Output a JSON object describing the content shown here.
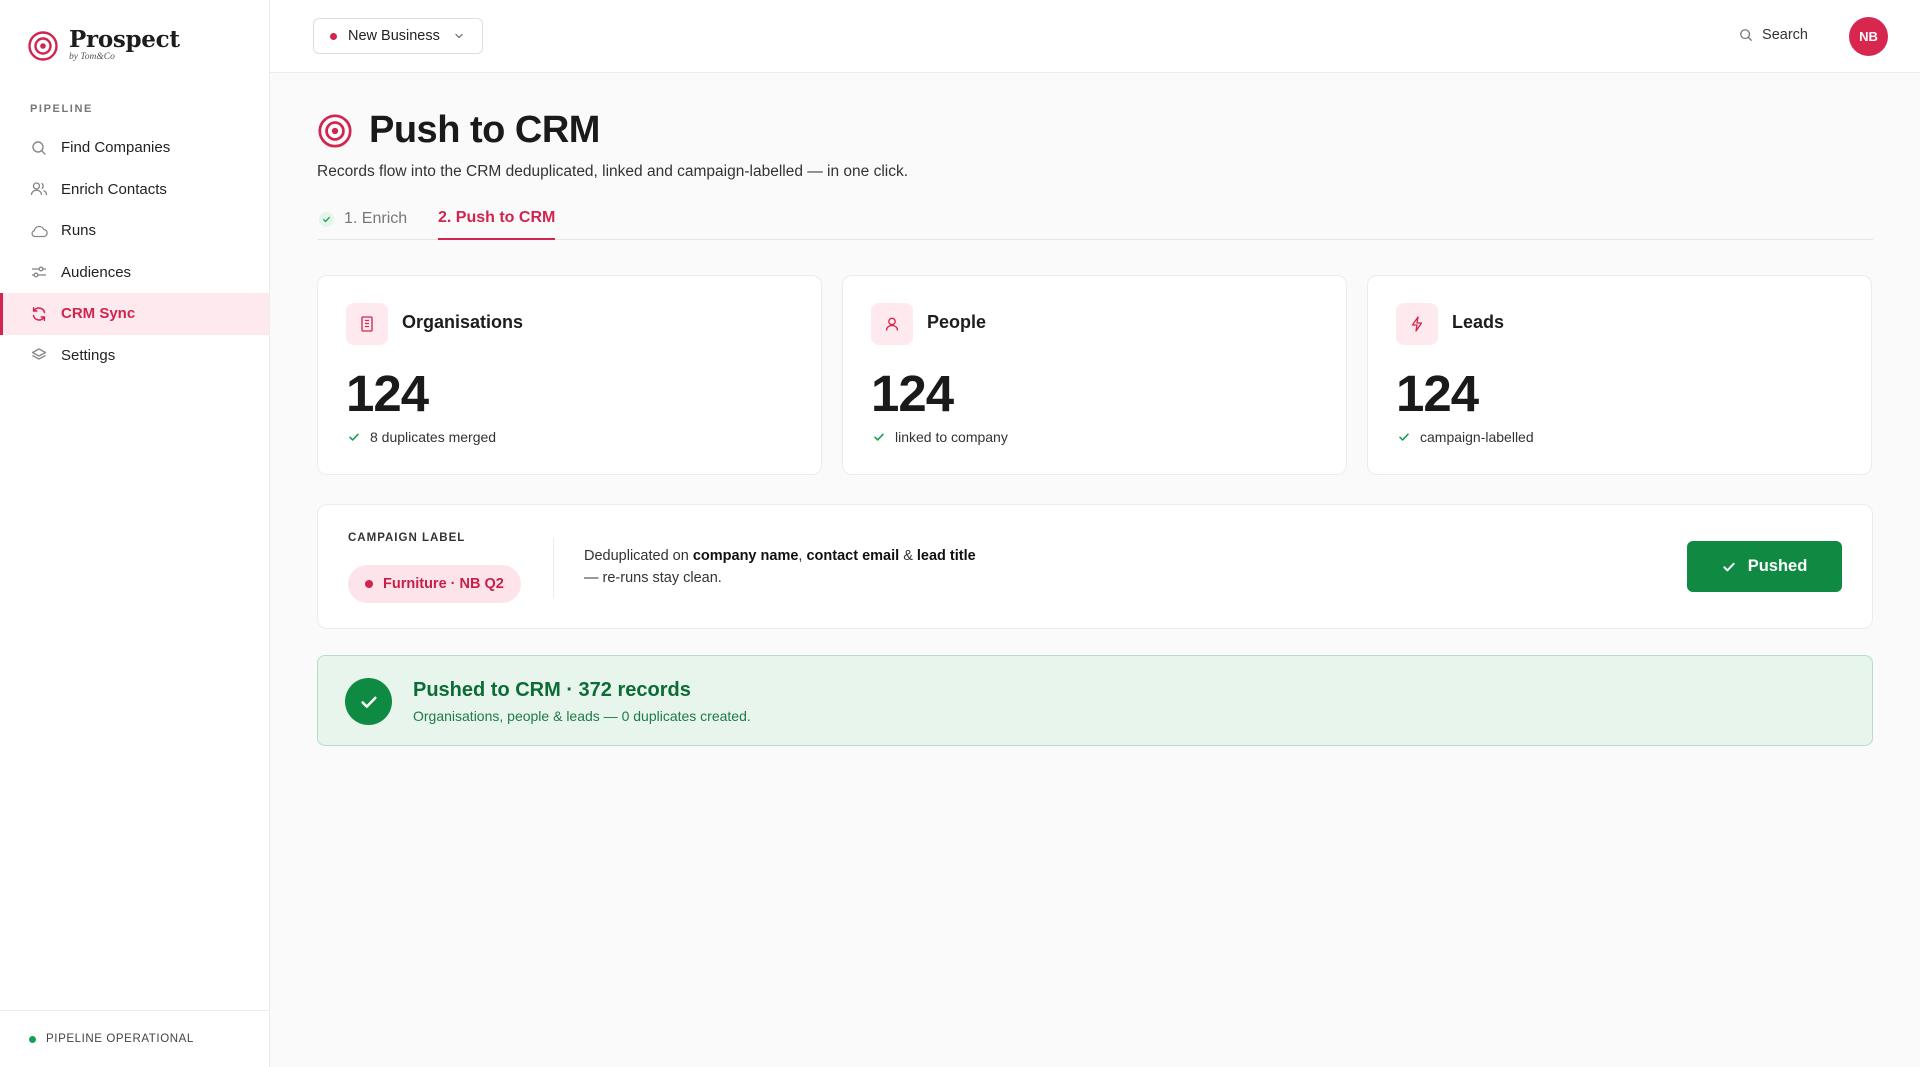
{
  "brand": {
    "name": "Prospect",
    "byline": "by Tom&Co"
  },
  "sidebar": {
    "section_title": "PIPELINE",
    "items": [
      {
        "label": "Find Companies",
        "icon": "search-icon",
        "active": false
      },
      {
        "label": "Enrich Contacts",
        "icon": "users-icon",
        "active": false
      },
      {
        "label": "Runs",
        "icon": "cloud-icon",
        "active": false
      },
      {
        "label": "Audiences",
        "icon": "sliders-icon",
        "active": false
      },
      {
        "label": "CRM Sync",
        "icon": "sync-icon",
        "active": true
      },
      {
        "label": "Settings",
        "icon": "layers-icon",
        "active": false
      }
    ],
    "footer_status": "PIPELINE OPERATIONAL"
  },
  "topbar": {
    "workspace": "New Business",
    "search_label": "Search",
    "avatar_initials": "NB"
  },
  "page": {
    "title": "Push to CRM",
    "subtitle": "Records flow into the CRM deduplicated, linked and campaign-labelled — in one click.",
    "tabs": [
      {
        "label": "1. Enrich",
        "state": "done"
      },
      {
        "label": "2. Push to CRM",
        "state": "active"
      }
    ]
  },
  "cards": [
    {
      "label": "Organisations",
      "icon": "building-icon",
      "value": "124",
      "note": "8 duplicates merged"
    },
    {
      "label": "People",
      "icon": "person-icon",
      "value": "124",
      "note": "linked to company"
    },
    {
      "label": "Leads",
      "icon": "bolt-icon",
      "value": "124",
      "note": "campaign-labelled"
    }
  ],
  "campaign": {
    "title": "CAMPAIGN LABEL",
    "chip": "Furniture · NB Q2",
    "dedup_prefix": "Deduplicated on",
    "key1": "company name",
    "sep1": ",",
    "key2": "contact email",
    "sep2": "&",
    "key3": "lead title",
    "dedup_suffix": "— re-runs stay clean.",
    "button_label": "Pushed"
  },
  "banner": {
    "title": "Pushed to CRM · 372 records",
    "subtitle": "Organisations, people & leads — 0 duplicates created."
  },
  "colors": {
    "accent": "#d1244e",
    "success": "#108a43",
    "success_bg": "#e7f5ec"
  }
}
